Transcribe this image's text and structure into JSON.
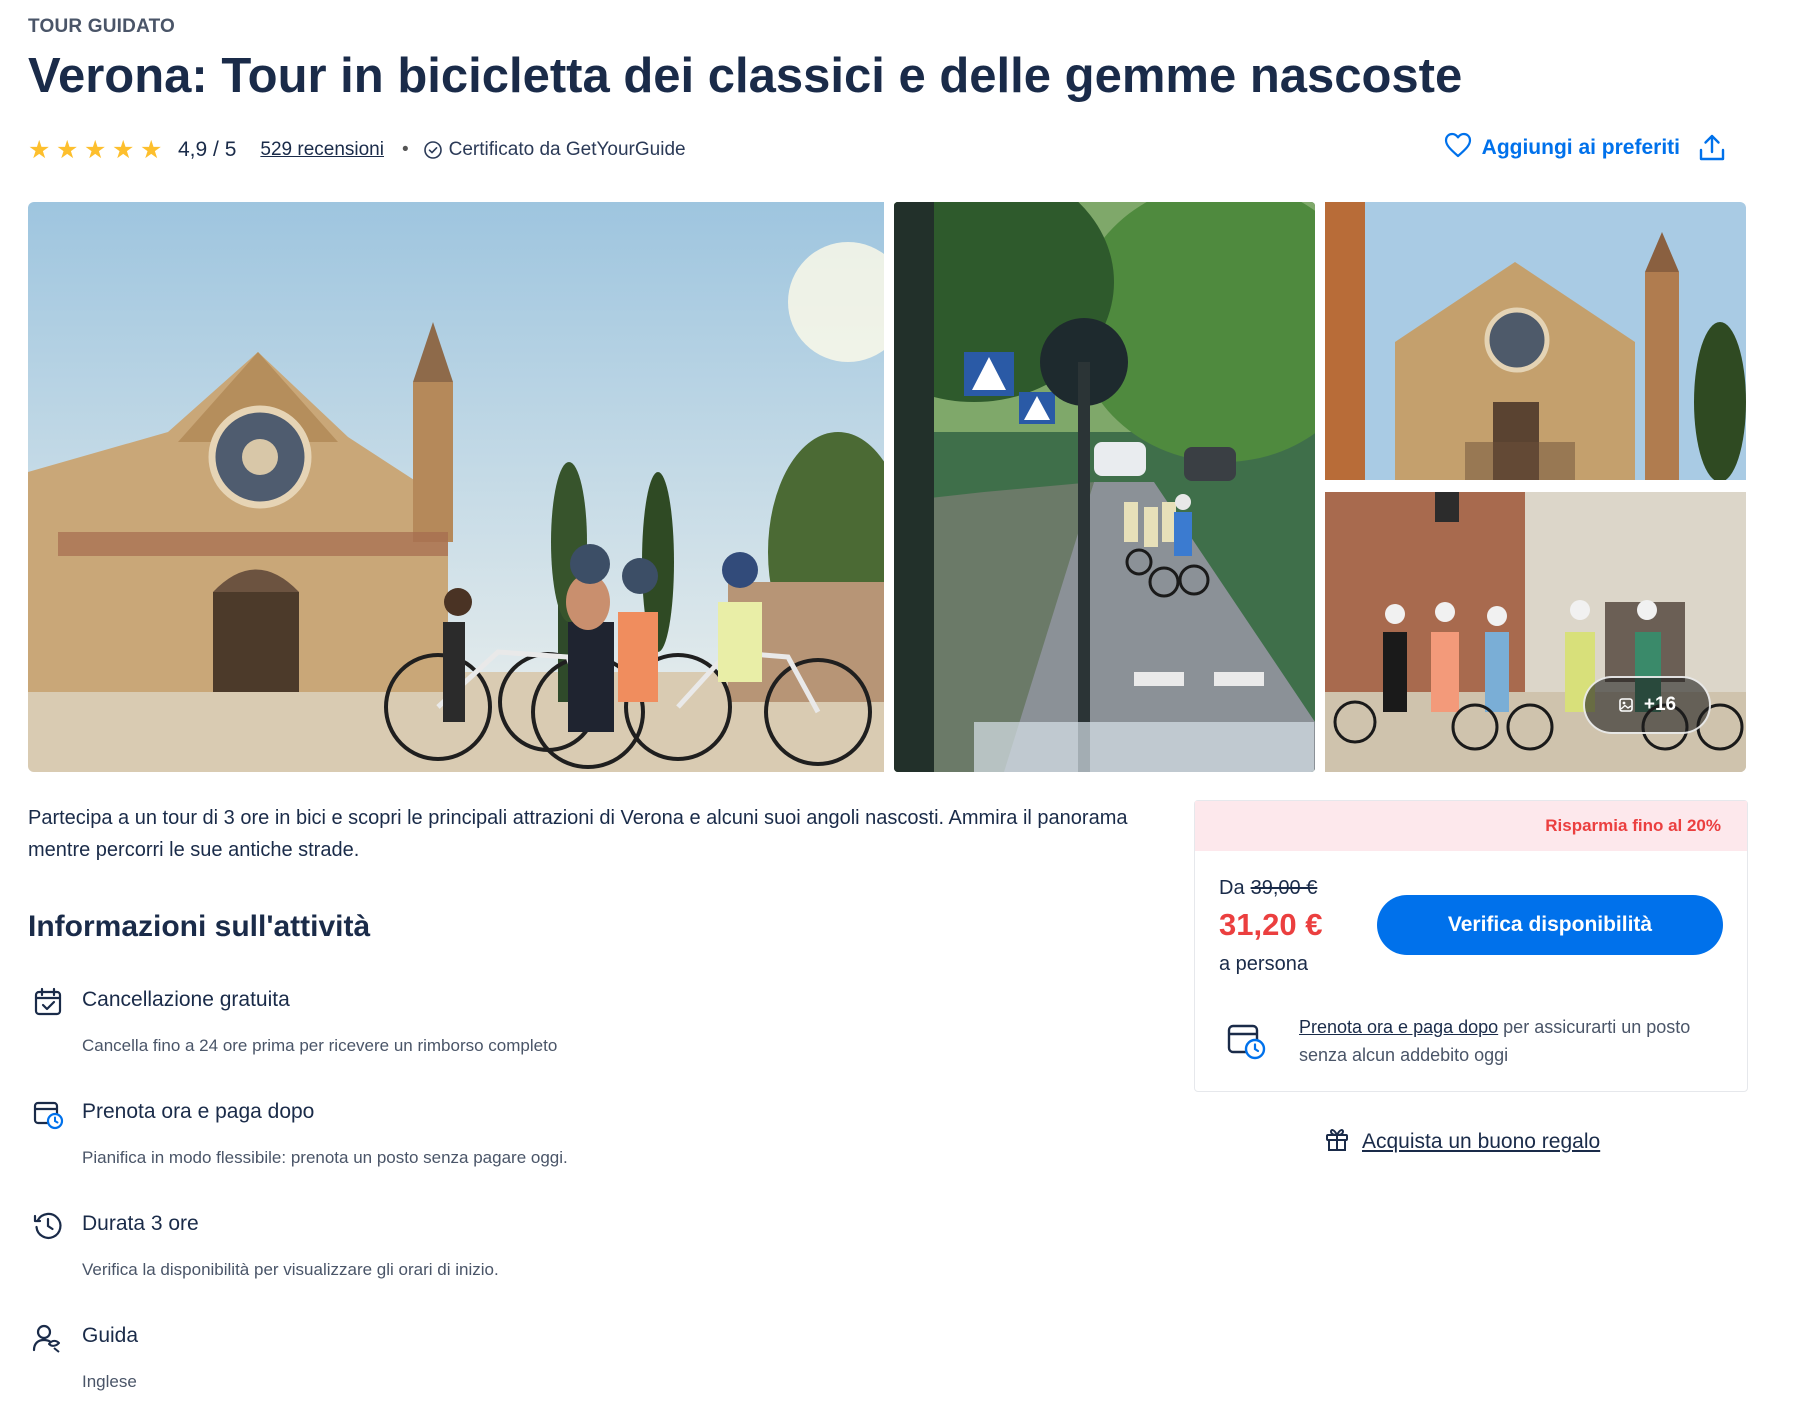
{
  "activity": {
    "category": "TOUR GUIDATO",
    "title": "Verona: Tour in bicicletta dei classici e delle gemme nascoste"
  },
  "rating": {
    "stars": 5,
    "score": "4,9 / 5",
    "reviews_label": "529 recensioni",
    "separator": "•",
    "certified": "Certificato da GetYourGuide"
  },
  "actions": {
    "wishlist_label": "Aggiungi ai preferiti",
    "share_icon": "share-icon"
  },
  "gallery": {
    "more_photos": "+16"
  },
  "description": "Partecipa a un tour di 3 ore in bici e scopri le principali attrazioni di Verona e alcuni suoi angoli nascosti. Ammira il panorama mentre percorri le sue antiche strade.",
  "info": {
    "heading": "Informazioni sull'attività",
    "items": [
      {
        "icon": "calendar-check-icon",
        "title": "Cancellazione gratuita",
        "subtitle": "Cancella fino a 24 ore prima per ricevere un rimborso completo"
      },
      {
        "icon": "calendar-clock-icon",
        "title": "Prenota ora e paga dopo",
        "subtitle": "Pianifica in modo flessibile: prenota un posto senza pagare oggi."
      },
      {
        "icon": "clock-icon",
        "title": "Durata 3 ore",
        "subtitle": "Verifica la disponibilità per visualizzare gli orari di inizio."
      },
      {
        "icon": "guide-icon",
        "title": "Guida",
        "subtitle": "Inglese"
      }
    ]
  },
  "booking": {
    "promo": "Risparmia fino al 20%",
    "from_label": "Da",
    "old_price": "39,00 €",
    "new_price": "31,20 €",
    "per_person": "a persona",
    "cta": "Verifica disponibilità",
    "rnpl_link": "Prenota ora e paga dopo",
    "rnpl_text": " per assicurarti un posto senza alcun addebito oggi"
  },
  "gift": {
    "label": "Acquista un buono regalo"
  },
  "colors": {
    "brand_blue": "#0071eb",
    "navy": "#1a2b49",
    "price_red": "#eb3f3f",
    "star_yellow": "#fdbf2d",
    "promo_bg": "#fde8ec"
  }
}
